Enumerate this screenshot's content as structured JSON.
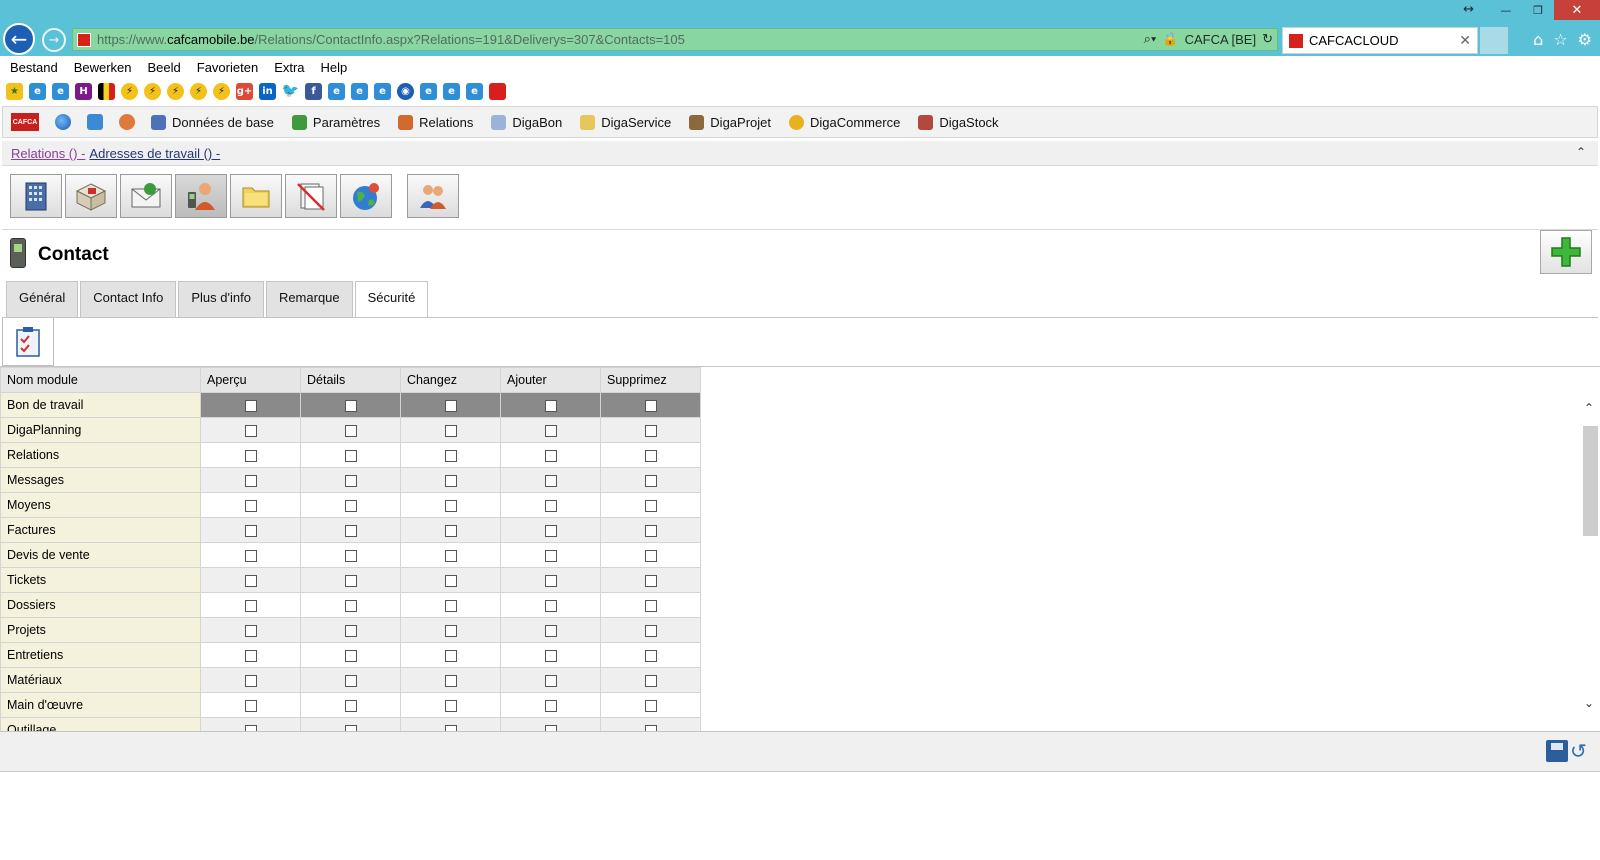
{
  "browser": {
    "url_prefix": "https://www.",
    "url_domain": "cafcamobile.be",
    "url_path": "/Relations/ContactInfo.aspx?Relations=191&Deliverys=307&Contacts=105",
    "site_identity": "CAFCA [BE]",
    "tab_title": "CAFCACLOUD"
  },
  "menu": [
    "Bestand",
    "Bewerken",
    "Beeld",
    "Favorieten",
    "Extra",
    "Help"
  ],
  "appbar": {
    "items": [
      "Données de base",
      "Paramètres",
      "Relations",
      "DigaBon",
      "DigaService",
      "DigaProjet",
      "DigaCommerce",
      "DigaStock"
    ],
    "logo_text": "CAFCA"
  },
  "breadcrumb": {
    "part1": "Relations () -",
    "part2": "Adresses de travail () -"
  },
  "page": {
    "title": "Contact"
  },
  "tabs": [
    "Général",
    "Contact Info",
    "Plus d'info",
    "Remarque",
    "Sécurité"
  ],
  "active_tab": "Sécurité",
  "permissions": {
    "columns": [
      "Nom module",
      "Aperçu",
      "Détails",
      "Changez",
      "Ajouter",
      "Supprimez"
    ],
    "rows": [
      "Bon de travail",
      "DigaPlanning",
      "Relations",
      "Messages",
      "Moyens",
      "Factures",
      "Devis de vente",
      "Tickets",
      "Dossiers",
      "Projets",
      "Entretiens",
      "Matériaux",
      "Main d'œuvre",
      "Outillage"
    ],
    "highlighted_row": "Bon de travail"
  },
  "colors": {
    "chrome": "#5bc1d6",
    "address_bar": "#88d6a0",
    "name_column": "#f4f2dc",
    "highlight_row": "#8a8a8a"
  }
}
